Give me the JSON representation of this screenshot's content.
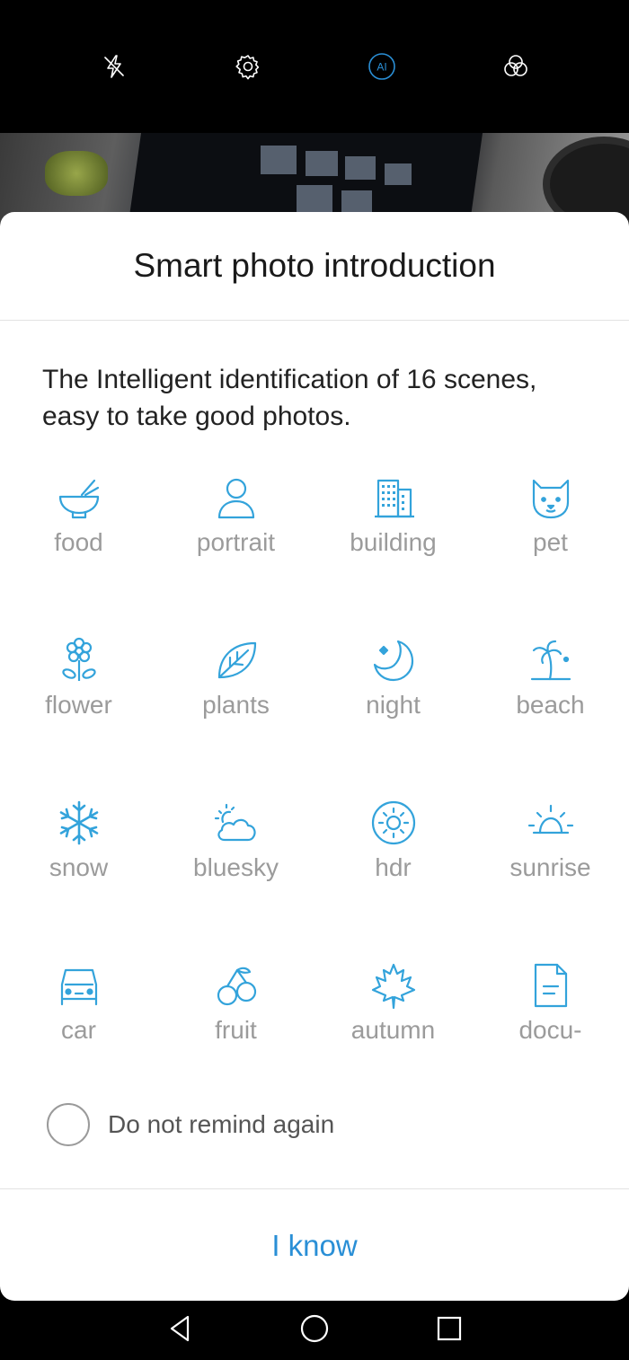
{
  "colors": {
    "accent": "#2a8fd6",
    "icon_blue": "#33a3db",
    "label_gray": "#9b9b9b"
  },
  "camera_toolbar": {
    "icons": [
      "flash-off-icon",
      "gear-icon",
      "ai-icon",
      "filter-icon"
    ],
    "ai_label": "AI"
  },
  "dialog": {
    "title": "Smart photo introduction",
    "description": "The Intelligent identification of 16 scenes, easy to take good photos.",
    "scenes": [
      {
        "label": "food",
        "icon": "food-bowl-icon"
      },
      {
        "label": "portrait",
        "icon": "portrait-icon"
      },
      {
        "label": "building",
        "icon": "building-icon"
      },
      {
        "label": "pet",
        "icon": "pet-icon"
      },
      {
        "label": "flower",
        "icon": "flower-icon"
      },
      {
        "label": "plants",
        "icon": "leaf-icon"
      },
      {
        "label": "night",
        "icon": "moon-icon"
      },
      {
        "label": "beach",
        "icon": "palm-tree-icon"
      },
      {
        "label": "snow",
        "icon": "snowflake-icon"
      },
      {
        "label": "bluesky",
        "icon": "cloud-sun-icon"
      },
      {
        "label": "hdr",
        "icon": "hdr-icon"
      },
      {
        "label": "sunrise",
        "icon": "sunrise-icon"
      },
      {
        "label": "car",
        "icon": "car-icon"
      },
      {
        "label": "fruit",
        "icon": "cherries-icon"
      },
      {
        "label": "autumn",
        "icon": "maple-leaf-icon"
      },
      {
        "label": "docu-",
        "icon": "document-icon"
      }
    ],
    "remind_checkbox": {
      "label": "Do not remind again",
      "checked": false
    },
    "confirm_button": "I know"
  },
  "navbar": {
    "icons": [
      "back-icon",
      "home-icon",
      "recents-icon"
    ]
  }
}
